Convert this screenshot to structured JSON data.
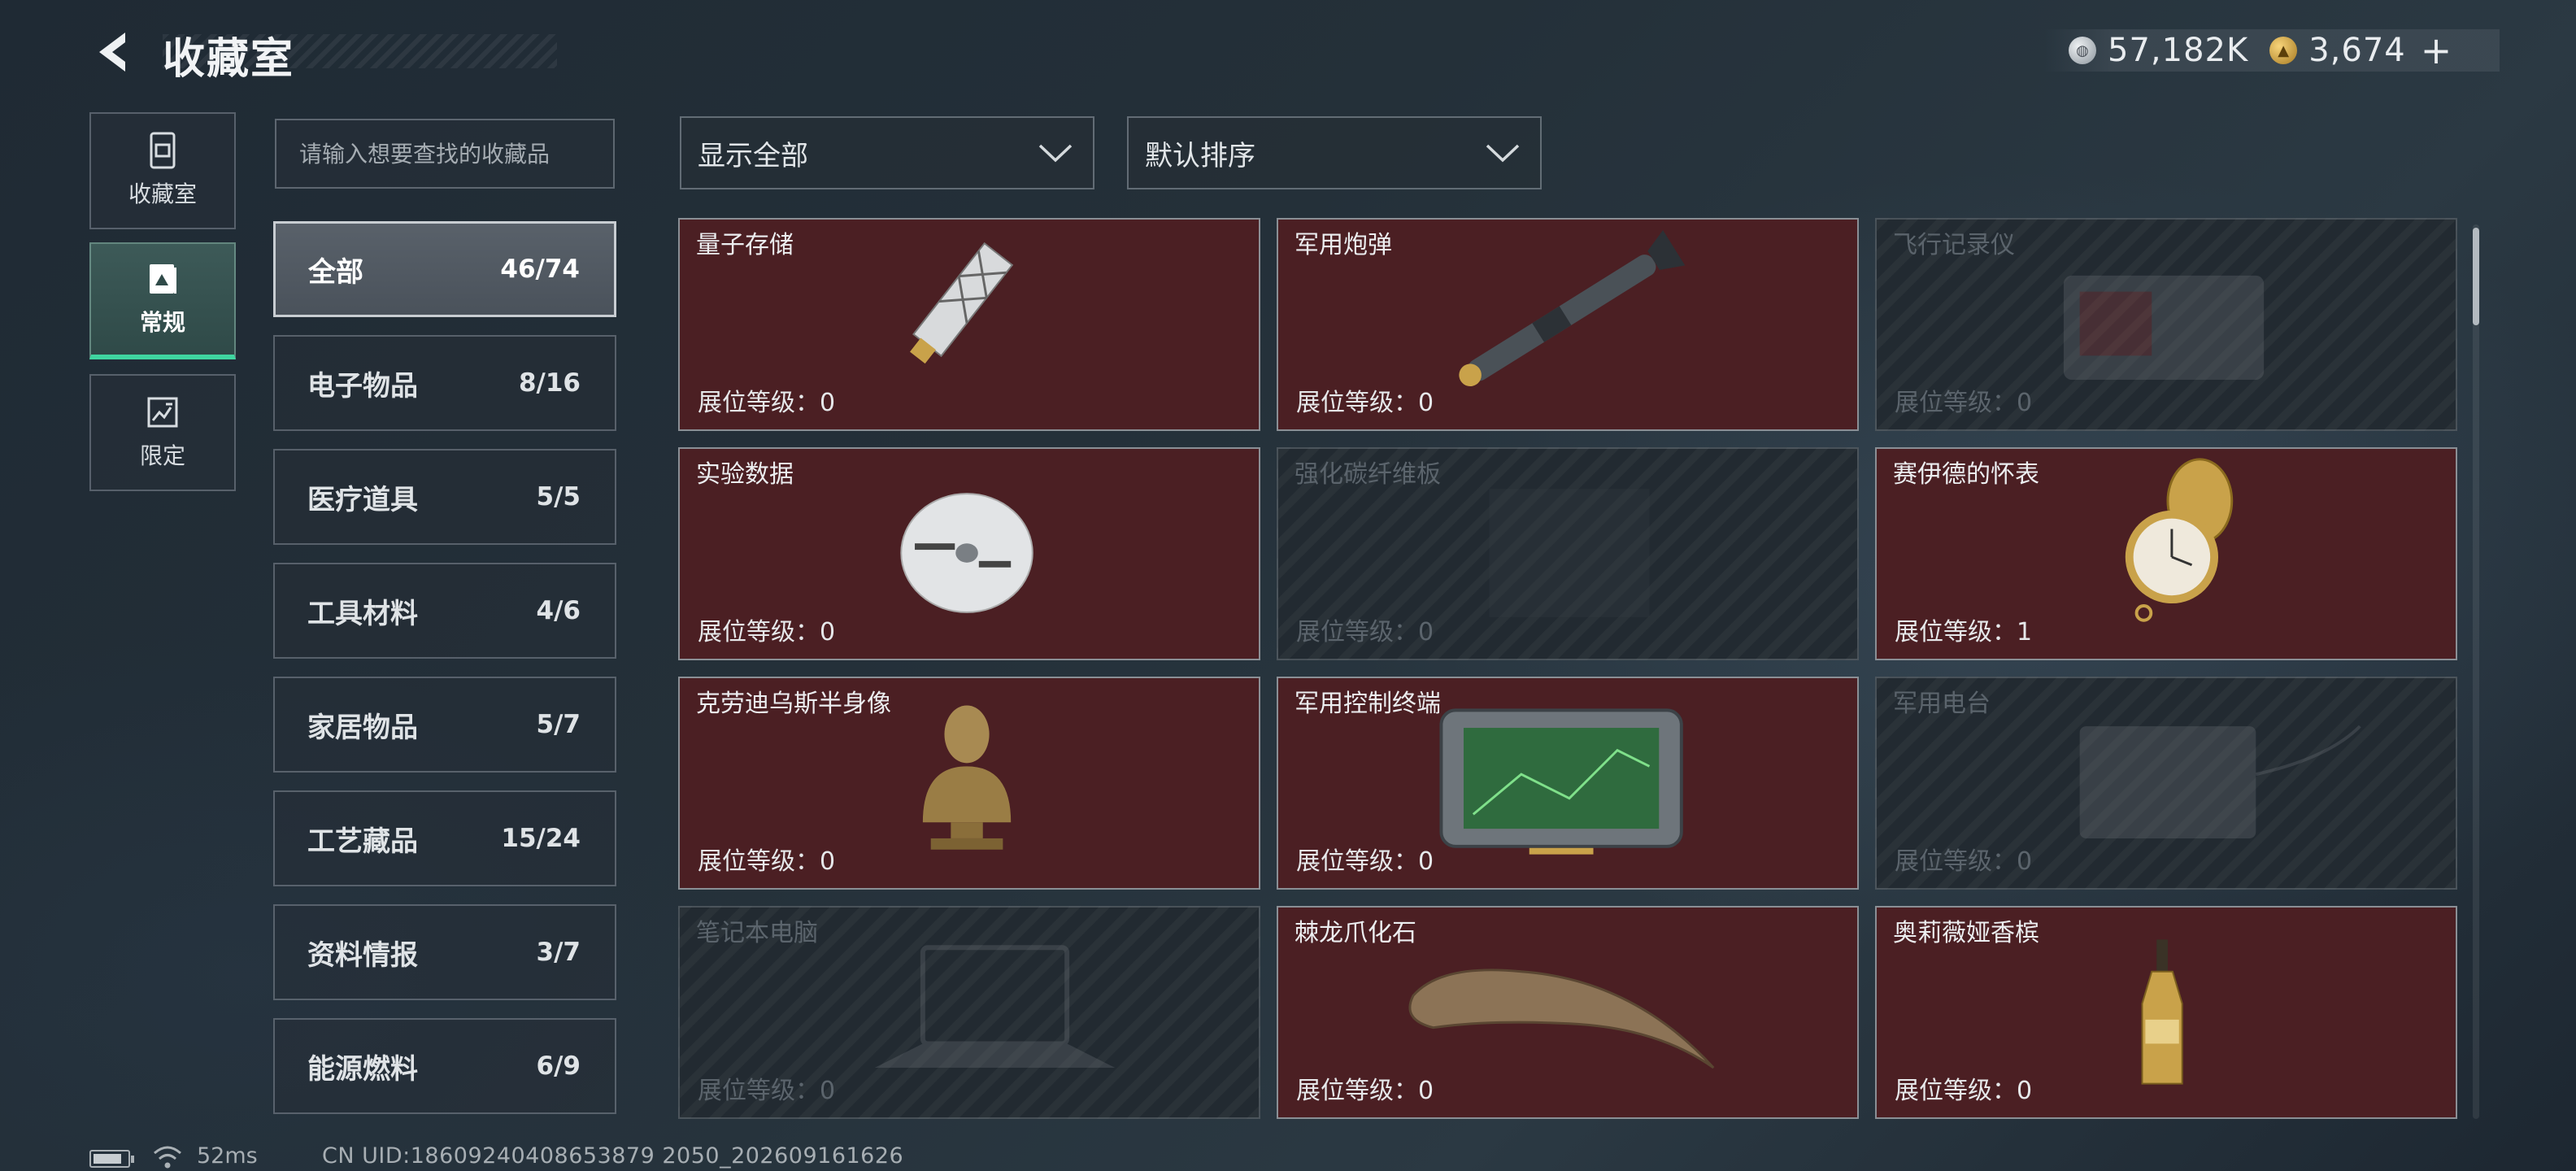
{
  "header": {
    "title": "收藏室"
  },
  "currency": {
    "silver_value": "57,182K",
    "gold_value": "3,674",
    "add_label": "+"
  },
  "rail_tabs": [
    {
      "label": "收藏室",
      "icon": "collection-room-icon"
    },
    {
      "label": "常规",
      "icon": "regular-icon",
      "active": true
    },
    {
      "label": "限定",
      "icon": "limited-icon"
    }
  ],
  "search": {
    "placeholder": "请输入想要查找的收藏品"
  },
  "categories": [
    {
      "label": "全部",
      "count": "46/74",
      "active": true
    },
    {
      "label": "电子物品",
      "count": "8/16"
    },
    {
      "label": "医疗道具",
      "count": "5/5"
    },
    {
      "label": "工具材料",
      "count": "4/6"
    },
    {
      "label": "家居物品",
      "count": "5/7"
    },
    {
      "label": "工艺藏品",
      "count": "15/24"
    },
    {
      "label": "资料情报",
      "count": "3/7"
    },
    {
      "label": "能源燃料",
      "count": "6/9"
    }
  ],
  "filters": {
    "display_value": "显示全部",
    "sort_value": "默认排序"
  },
  "items": [
    {
      "name": "量子存储",
      "level_label": "展位等级：0",
      "icon": "usb-drive-icon",
      "unlocked": true
    },
    {
      "name": "军用炮弹",
      "level_label": "展位等级：0",
      "icon": "missile-icon",
      "unlocked": true
    },
    {
      "name": "飞行记录仪",
      "level_label": "展位等级：0",
      "icon": "flight-recorder-icon",
      "unlocked": false
    },
    {
      "name": "实验数据",
      "level_label": "展位等级：0",
      "icon": "disc-icon",
      "unlocked": true
    },
    {
      "name": "强化碳纤维板",
      "level_label": "展位等级：0",
      "icon": "carbon-plate-icon",
      "unlocked": false
    },
    {
      "name": "赛伊德的怀表",
      "level_label": "展位等级：1",
      "icon": "pocket-watch-icon",
      "unlocked": true
    },
    {
      "name": "克劳迪乌斯半身像",
      "level_label": "展位等级：0",
      "icon": "bust-icon",
      "unlocked": true
    },
    {
      "name": "军用控制终端",
      "level_label": "展位等级：0",
      "icon": "tablet-terminal-icon",
      "unlocked": true
    },
    {
      "name": "军用电台",
      "level_label": "展位等级：0",
      "icon": "radio-icon",
      "unlocked": false
    },
    {
      "name": "笔记本电脑",
      "level_label": "展位等级：0",
      "icon": "laptop-icon",
      "unlocked": false
    },
    {
      "name": "棘龙爪化石",
      "level_label": "展位等级：0",
      "icon": "claw-fossil-icon",
      "unlocked": true
    },
    {
      "name": "奥莉薇娅香槟",
      "level_label": "展位等级：0",
      "icon": "champagne-icon",
      "unlocked": true
    }
  ],
  "status": {
    "ping": "52ms",
    "uid": "CN UID:18609240408653879 2050_202609161626"
  }
}
